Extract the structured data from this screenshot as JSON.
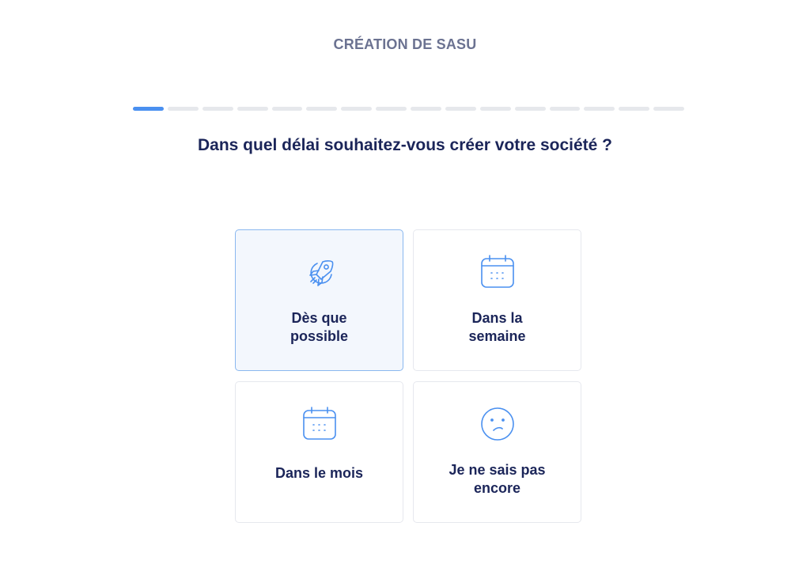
{
  "header": {
    "title": "CRÉATION DE SASU"
  },
  "progress": {
    "total_steps": 16,
    "current_step": 1,
    "active_color": "#4a90f0"
  },
  "question": {
    "text": "Dans quel délai souhaitez-vous créer votre société ?"
  },
  "options": [
    {
      "line1": "Dès que",
      "line2": "possible",
      "icon": "rocket-icon",
      "selected": true
    },
    {
      "line1": "Dans la",
      "line2": "semaine",
      "icon": "calendar-icon",
      "selected": false
    },
    {
      "line1": "Dans le mois",
      "icon": "calendar-icon",
      "selected": false
    },
    {
      "line1": "Je ne sais pas",
      "line2": "encore",
      "icon": "confused-face-icon",
      "selected": false
    }
  ],
  "colors": {
    "icon_blue": "#4a90f0",
    "text_dark": "#1b2559",
    "selected_bg": "#f3f7fd"
  }
}
